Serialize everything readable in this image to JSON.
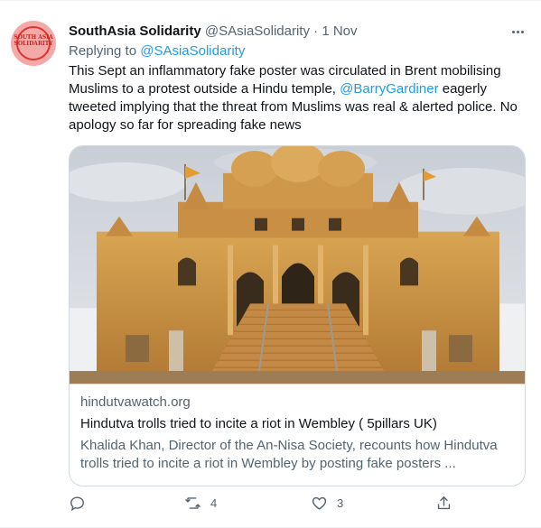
{
  "author": {
    "name": "SouthAsia Solidarity",
    "handle": "@SAsiaSolidarity",
    "separator": "·",
    "date": "1 Nov",
    "avatar_text": "SOUTH ASIA SOLIDARITY"
  },
  "reply": {
    "prefix": "Replying to",
    "target": "@SAsiaSolidarity"
  },
  "tweet": {
    "text_part1": "This Sept an inflammatory fake poster was circulated in Brent mobilising Muslims to a protest outside a Hindu temple, ",
    "mention": "@BarryGardiner",
    "text_part2": " eagerly tweeted implying that the threat from Muslims was real & alerted police. No apology so far for spreading fake news"
  },
  "card": {
    "domain": "hindutvawatch.org",
    "title": "Hindutva trolls tried to incite a riot in Wembley ( 5pillars UK)",
    "description": "Khalida Khan, Director of the An-Nisa Society, recounts how Hindutva trolls tried to incite a riot in Wembley by posting fake posters ..."
  },
  "actions": {
    "reply_icon": "reply-icon",
    "retweet_icon": "retweet-icon",
    "retweet_count": "4",
    "like_icon": "heart-icon",
    "like_count": "3",
    "share_icon": "share-icon"
  },
  "colors": {
    "accent": "#1d9bf0",
    "secondary_text": "#536471",
    "primary_text": "#0f1419",
    "border": "#cfd9de"
  }
}
